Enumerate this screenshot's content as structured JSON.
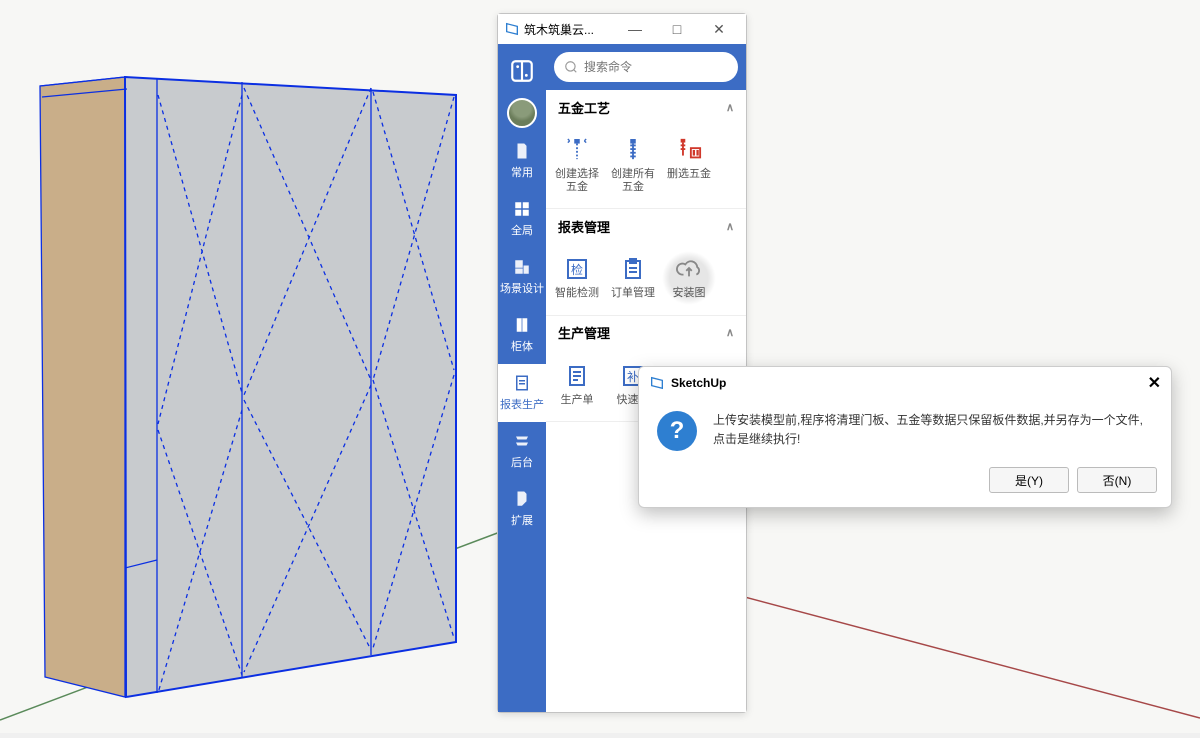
{
  "window": {
    "title": "筑木筑巢云...",
    "minimize": "—",
    "maximize": "□",
    "close": "✕"
  },
  "search": {
    "placeholder": "搜索命令"
  },
  "sidebar": {
    "items": [
      {
        "label": "常用",
        "icon": "common"
      },
      {
        "label": "全局",
        "icon": "global"
      },
      {
        "label": "场景设计",
        "icon": "scene"
      },
      {
        "label": "柜体",
        "icon": "cabinet"
      },
      {
        "label": "报表生产",
        "icon": "report",
        "active": true
      },
      {
        "label": "后台",
        "icon": "backend"
      },
      {
        "label": "扩展",
        "icon": "extend"
      }
    ]
  },
  "sections": [
    {
      "title": "五金工艺",
      "items": [
        {
          "label": "创建选择五金",
          "icon": "bolt-blue",
          "color": "#3c6cc4"
        },
        {
          "label": "创建所有五金",
          "icon": "bolt-blue2",
          "color": "#3c6cc4"
        },
        {
          "label": "删选五金",
          "icon": "bolt-red",
          "color": "#d0382b"
        }
      ]
    },
    {
      "title": "报表管理",
      "items": [
        {
          "label": "智能检测",
          "icon": "check",
          "color": "#3c6cc4"
        },
        {
          "label": "订单管理",
          "icon": "clipboard",
          "color": "#3c6cc4"
        },
        {
          "label": "安装图",
          "icon": "upload",
          "color": "#888",
          "highlight": true
        }
      ]
    },
    {
      "title": "生产管理",
      "items": [
        {
          "label": "生产单",
          "icon": "doc",
          "color": "#3c6cc4"
        },
        {
          "label": "快速补",
          "icon": "supply",
          "color": "#3c6cc4"
        }
      ]
    }
  ],
  "dialog": {
    "title": "SketchUp",
    "message": "上传安装模型前,程序将清理门板、五金等数据只保留板件数据,并另存为一个文件,点击是继续执行!",
    "yes": "是(Y)",
    "no": "否(N)"
  }
}
